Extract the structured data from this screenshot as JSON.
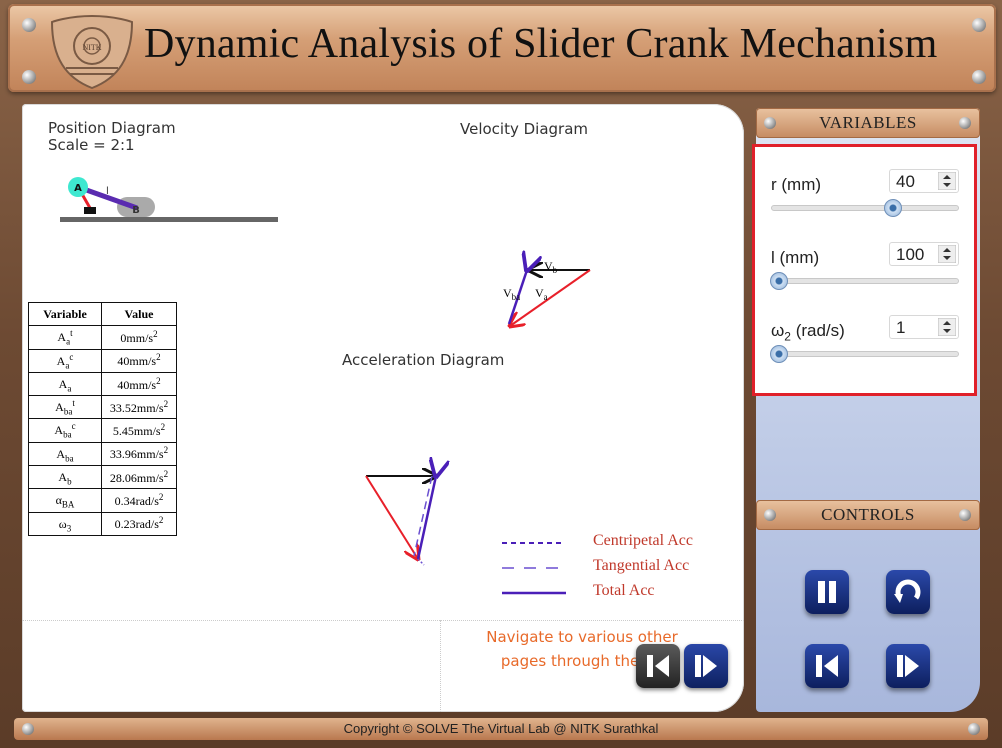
{
  "header": {
    "title": "Dynamic Analysis of Slider Crank Mechanism",
    "logo_text": "NITK"
  },
  "diagrams": {
    "position_title": "Position Diagram",
    "position_scale": "Scale = 2:1",
    "velocity_title": "Velocity Diagram",
    "acceleration_title": "Acceleration Diagram",
    "labels": {
      "point_a": "A",
      "point_b": "B",
      "link_l": "l",
      "vb": "V",
      "vb_sub": "b",
      "vba": "V",
      "vba_sub": "ba",
      "va": "V",
      "va_sub": "a"
    }
  },
  "table": {
    "headers": [
      "Variable",
      "Value"
    ],
    "rows": [
      {
        "sym": "A",
        "sub": "a",
        "sup": "t",
        "val": "0mm/s",
        "unit_sup": "2"
      },
      {
        "sym": "A",
        "sub": "a",
        "sup": "c",
        "val": "40mm/s",
        "unit_sup": "2"
      },
      {
        "sym": "A",
        "sub": "a",
        "sup": "",
        "val": "40mm/s",
        "unit_sup": "2"
      },
      {
        "sym": "A",
        "sub": "ba",
        "sup": "t",
        "val": "33.52mm/s",
        "unit_sup": "2"
      },
      {
        "sym": "A",
        "sub": "ba",
        "sup": "c",
        "val": "5.45mm/s",
        "unit_sup": "2"
      },
      {
        "sym": "A",
        "sub": "ba",
        "sup": "",
        "val": "33.96mm/s",
        "unit_sup": "2"
      },
      {
        "sym": "A",
        "sub": "b",
        "sup": "",
        "val": "28.06mm/s",
        "unit_sup": "2"
      },
      {
        "sym": "α",
        "sub": "BA",
        "sup": "",
        "val": "0.34rad/s",
        "unit_sup": "2"
      },
      {
        "sym": "ω",
        "sub": "3",
        "sup": "",
        "val": "0.23rad/s",
        "unit_sup": "2"
      }
    ]
  },
  "legend": {
    "centripetal": "Centripetal Acc",
    "tangential": "Tangential Acc",
    "total": "Total Acc"
  },
  "nav": {
    "text_line1": "Navigate to various other",
    "text_line2": "pages through the bu"
  },
  "variables": {
    "heading": "VARIABLES",
    "r": {
      "label": "r (mm)",
      "value": "40",
      "level": 0.67
    },
    "l": {
      "label": "l (mm)",
      "value": "100",
      "level": 0.0
    },
    "w2": {
      "label_main": "ω",
      "label_sub": "2",
      "label_rest": " (rad/s)",
      "value": "1",
      "level": 0.0
    }
  },
  "controls": {
    "heading": "CONTROLS"
  },
  "footer": {
    "copyright": "Copyright © SOLVE The Virtual Lab @ NITK Surathkal"
  },
  "colors": {
    "red_box": "#e0202a",
    "vector_red": "#e8202a",
    "vector_blue": "#4a1fb8",
    "nav_text": "#e86a2a",
    "legend_text": "#c0392b"
  }
}
